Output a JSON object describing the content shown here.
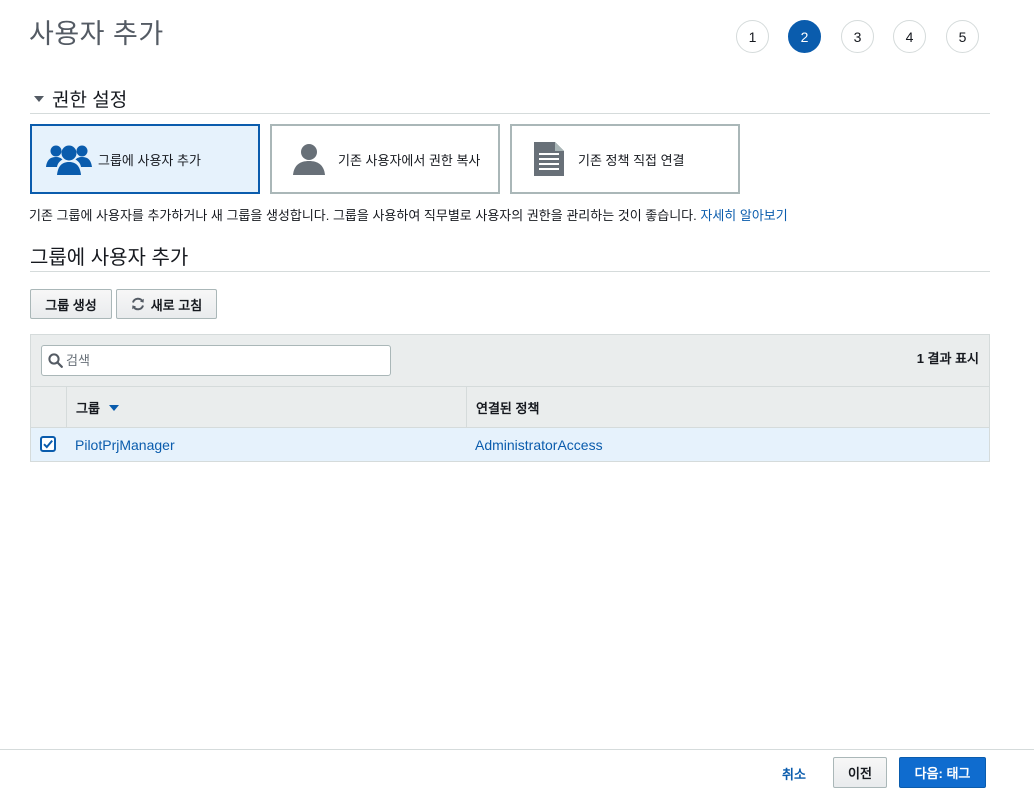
{
  "page": {
    "title": "사용자 추가"
  },
  "steps": [
    {
      "label": "1",
      "active": false
    },
    {
      "label": "2",
      "active": true
    },
    {
      "label": "3",
      "active": false
    },
    {
      "label": "4",
      "active": false
    },
    {
      "label": "5",
      "active": false
    }
  ],
  "permissions": {
    "title": "권한 설정",
    "options": [
      {
        "label": "그룹에 사용자 추가",
        "icon": "users-group-icon",
        "selected": true
      },
      {
        "label": "기존 사용자에서 권한 복사",
        "icon": "user-icon",
        "selected": false
      },
      {
        "label": "기존 정책 직접 연결",
        "icon": "document-icon",
        "selected": false
      }
    ],
    "description": "기존 그룹에 사용자를 추가하거나 새 그룹을 생성합니다. 그룹을 사용하여 직무별로 사용자의 권한을 관리하는 것이 좋습니다.",
    "learn_more": "자세히 알아보기"
  },
  "groups": {
    "title": "그룹에 사용자 추가",
    "create_button": "그룹 생성",
    "refresh_button": "새로 고침",
    "refresh_icon": "refresh-icon",
    "search": {
      "placeholder": "검색",
      "value": ""
    },
    "result_count": "1 결과 표시",
    "columns": {
      "group": "그룹",
      "policy": "연결된 정책"
    },
    "rows": [
      {
        "checked": true,
        "group": "PilotPrjManager",
        "policy": "AdministratorAccess"
      }
    ]
  },
  "footer": {
    "cancel": "취소",
    "previous": "이전",
    "next": "다음: 태그"
  },
  "colors": {
    "accent": "#0a5cad",
    "primary_button": "#0f6ccf",
    "selected_bg": "#e6f2fc"
  }
}
